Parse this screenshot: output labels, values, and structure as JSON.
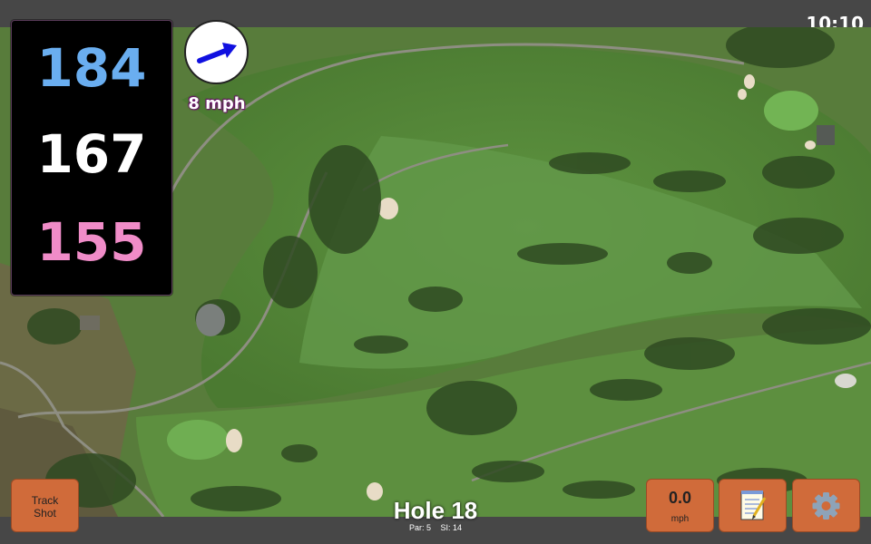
{
  "status": {
    "time": "10:10"
  },
  "distances": {
    "back": "184",
    "middle": "167",
    "front": "155"
  },
  "wind": {
    "speed_label": "8 mph"
  },
  "hole": {
    "title": "Hole 18",
    "par": "Par: 5",
    "si": "SI: 14"
  },
  "buttons": {
    "track_shot_line1": "Track",
    "track_shot_line2": "Shot",
    "speed_value": "0.0",
    "speed_unit": "mph"
  },
  "icons": {
    "notes": "notepad-icon",
    "settings": "gear-icon",
    "wind": "arrow-icon"
  },
  "colors": {
    "back": "#6aaef0",
    "middle": "#ffffff",
    "front": "#f08cc8",
    "button": "#d06b3a",
    "wind_arrow": "#1010e0"
  }
}
